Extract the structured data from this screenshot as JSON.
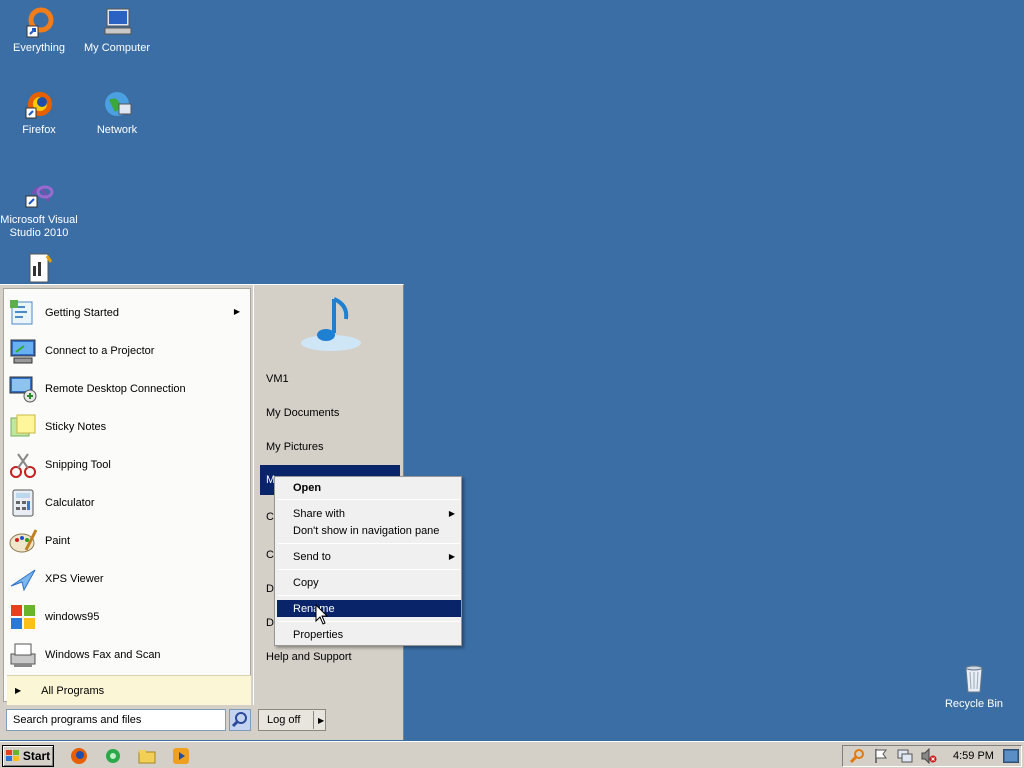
{
  "desktop": {
    "icons": [
      {
        "label": "Everything"
      },
      {
        "label": "My Computer"
      },
      {
        "label": "Firefox"
      },
      {
        "label": "Network"
      },
      {
        "label": "Microsoft Visual Studio 2010"
      },
      {
        "label": "Recycle Bin"
      }
    ],
    "background_color": "#3a6ea5"
  },
  "start_menu": {
    "programs": [
      {
        "label": "Getting Started",
        "has_submenu": true
      },
      {
        "label": "Connect to a Projector"
      },
      {
        "label": "Remote Desktop Connection"
      },
      {
        "label": "Sticky Notes"
      },
      {
        "label": "Snipping Tool"
      },
      {
        "label": "Calculator"
      },
      {
        "label": "Paint"
      },
      {
        "label": "XPS Viewer"
      },
      {
        "label": "windows95"
      },
      {
        "label": "Windows Fax and Scan"
      }
    ],
    "all_programs": "All Programs",
    "search_placeholder": "Search programs and files",
    "right_items": [
      {
        "label": "VM1"
      },
      {
        "label": "My Documents"
      },
      {
        "label": "My Pictures"
      },
      {
        "label": "M"
      },
      {
        "label": "C"
      },
      {
        "label": "C"
      },
      {
        "label": "D"
      },
      {
        "label": "D"
      },
      {
        "label": "Help and Support"
      }
    ],
    "logoff_label": "Log off"
  },
  "context_menu": {
    "items": [
      {
        "label": "Open"
      },
      {
        "label": "Share with"
      },
      {
        "label": "Don't show in navigation pane"
      },
      {
        "label": "Send to"
      },
      {
        "label": "Copy"
      },
      {
        "label": "Rename"
      },
      {
        "label": "Properties"
      }
    ]
  },
  "taskbar": {
    "start_label": "Start",
    "clock": "4:59 PM"
  },
  "colors": {
    "selection": "#0a246a",
    "menu_face": "#d4d0c8"
  }
}
